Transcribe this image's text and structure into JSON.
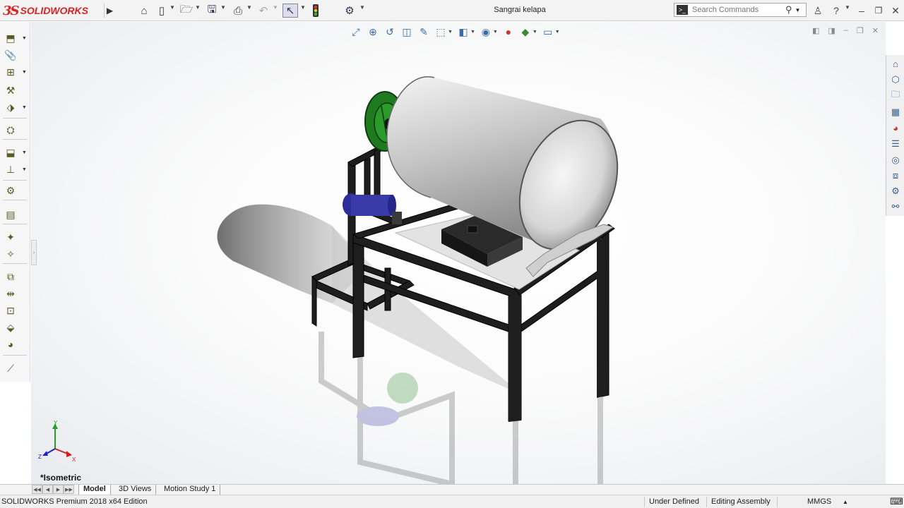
{
  "app": {
    "logo_ds": "3S",
    "logo_name": "SOLIDWORKS",
    "document_title": "Sangrai kelapa"
  },
  "search": {
    "placeholder": "Search Commands"
  },
  "viewport": {
    "view_label": "*Isometric",
    "triad": {
      "x": "X",
      "y": "Y",
      "z": "Z"
    }
  },
  "tabs": [
    {
      "label": "Model",
      "active": true
    },
    {
      "label": "3D Views",
      "active": false
    },
    {
      "label": "Motion Study 1",
      "active": false
    }
  ],
  "status": {
    "edition": "SOLIDWORKS Premium 2018 x64 Edition",
    "definition": "Under Defined",
    "mode": "Editing Assembly",
    "units": "MMGS",
    "units_arrow": "▲"
  },
  "colors": {
    "brand": "#d22222",
    "frame": "#1e1e1e",
    "drum": "#c9c9c9",
    "pulley": "#1f7a1f",
    "motor": "#3030a0"
  }
}
